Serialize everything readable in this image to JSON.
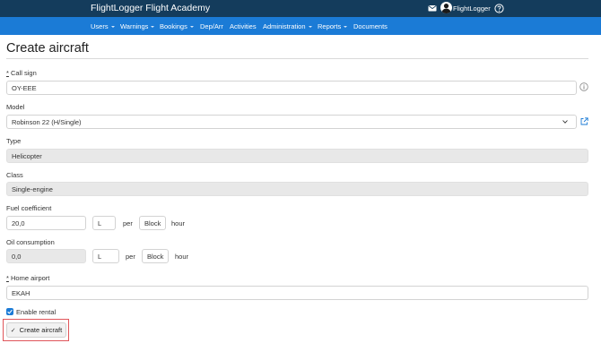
{
  "app": {
    "title": "FlightLogger Flight Academy",
    "user_name": "FlightLogger"
  },
  "nav": [
    {
      "label": "Users",
      "has_menu": true
    },
    {
      "label": "Warnings",
      "has_menu": true
    },
    {
      "label": "Bookings",
      "has_menu": true
    },
    {
      "label": "Dep/Arr",
      "has_menu": false
    },
    {
      "label": "Activities",
      "has_menu": false
    },
    {
      "label": "Administration",
      "has_menu": true
    },
    {
      "label": "Reports",
      "has_menu": true
    },
    {
      "label": "Documents",
      "has_menu": false
    }
  ],
  "page": {
    "title": "Create aircraft"
  },
  "form": {
    "call_sign": {
      "required_mark": "*",
      "label": "Call sign",
      "value": "OY-EEE"
    },
    "model": {
      "label": "Model",
      "value": "Robinson 22 (H/Single)"
    },
    "type": {
      "label": "Type",
      "value": "Helicopter"
    },
    "class": {
      "label": "Class",
      "value": "Single-engine"
    },
    "fuel": {
      "label": "Fuel coefficient",
      "value": "20,0",
      "unit": "L",
      "per": "per",
      "basis": "Block",
      "period": "hour"
    },
    "oil": {
      "label": "Oil consumption",
      "value": "0,0",
      "unit": "L",
      "per": "per",
      "basis": "Block",
      "period": "hour"
    },
    "home_airport": {
      "required_mark": "*",
      "label": "Home airport",
      "value": "EKAH"
    },
    "enable_rental": {
      "label": "Enable rental",
      "checked": true
    },
    "submit_label": "Create aircraft"
  },
  "colors": {
    "topbar": "#143c5c",
    "navbar": "#1b7bd6",
    "highlight": "#e0555a"
  },
  "icons": [
    "mail-icon",
    "avatar",
    "help-icon",
    "info-icon",
    "external-link-icon",
    "chevron-down-icon",
    "checkmark-icon"
  ]
}
